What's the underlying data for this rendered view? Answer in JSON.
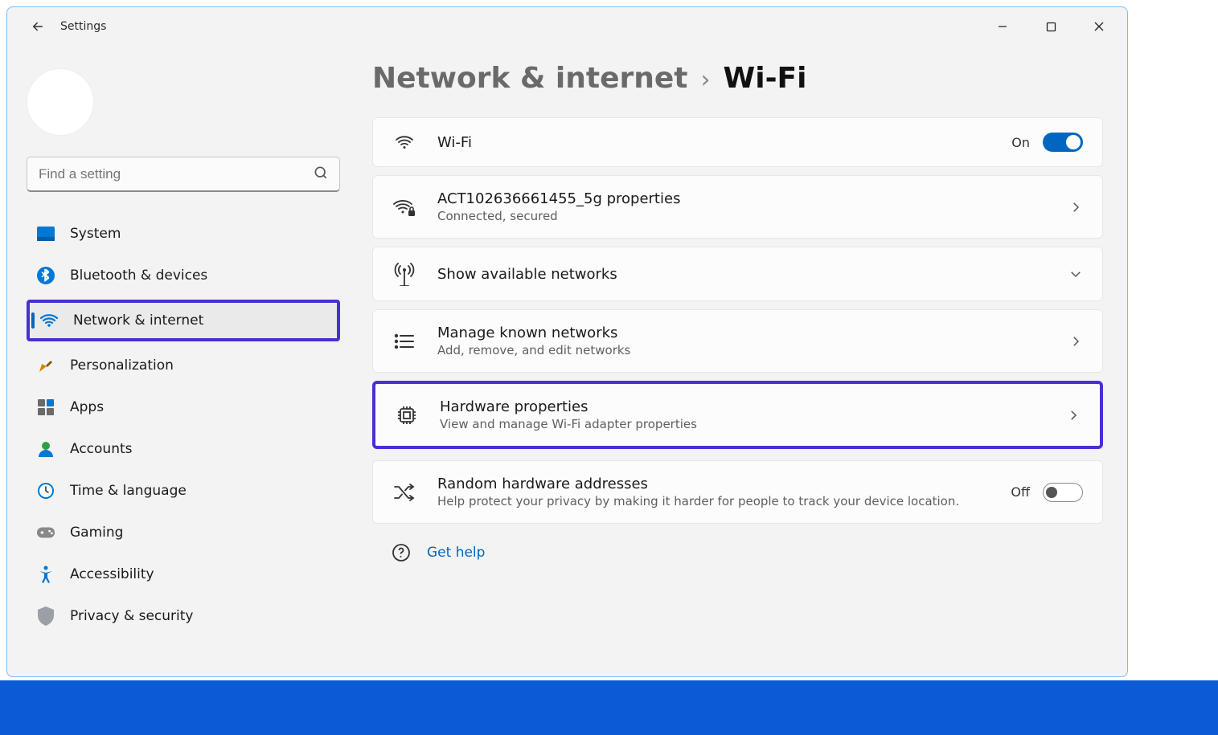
{
  "header": {
    "app_title": "Settings"
  },
  "sidebar": {
    "user": {
      "name": "",
      "email": ""
    },
    "search_placeholder": "Find a setting",
    "items": [
      {
        "label": "System"
      },
      {
        "label": "Bluetooth & devices"
      },
      {
        "label": "Network & internet"
      },
      {
        "label": "Personalization"
      },
      {
        "label": "Apps"
      },
      {
        "label": "Accounts"
      },
      {
        "label": "Time & language"
      },
      {
        "label": "Gaming"
      },
      {
        "label": "Accessibility"
      },
      {
        "label": "Privacy & security"
      }
    ]
  },
  "main": {
    "breadcrumb": {
      "parent": "Network & internet",
      "current": "Wi-Fi"
    },
    "cards": [
      {
        "title": "Wi-Fi",
        "state": "On"
      },
      {
        "title": "ACT102636661455_5g properties",
        "subtitle": "Connected, secured"
      },
      {
        "title": "Show available networks"
      },
      {
        "title": "Manage known networks",
        "subtitle": "Add, remove, and edit networks"
      },
      {
        "title": "Hardware properties",
        "subtitle": "View and manage Wi-Fi adapter properties"
      },
      {
        "title": "Random hardware addresses",
        "subtitle": "Help protect your privacy by making it harder for people to track your device location.",
        "state": "Off"
      }
    ],
    "help_label": "Get help"
  }
}
